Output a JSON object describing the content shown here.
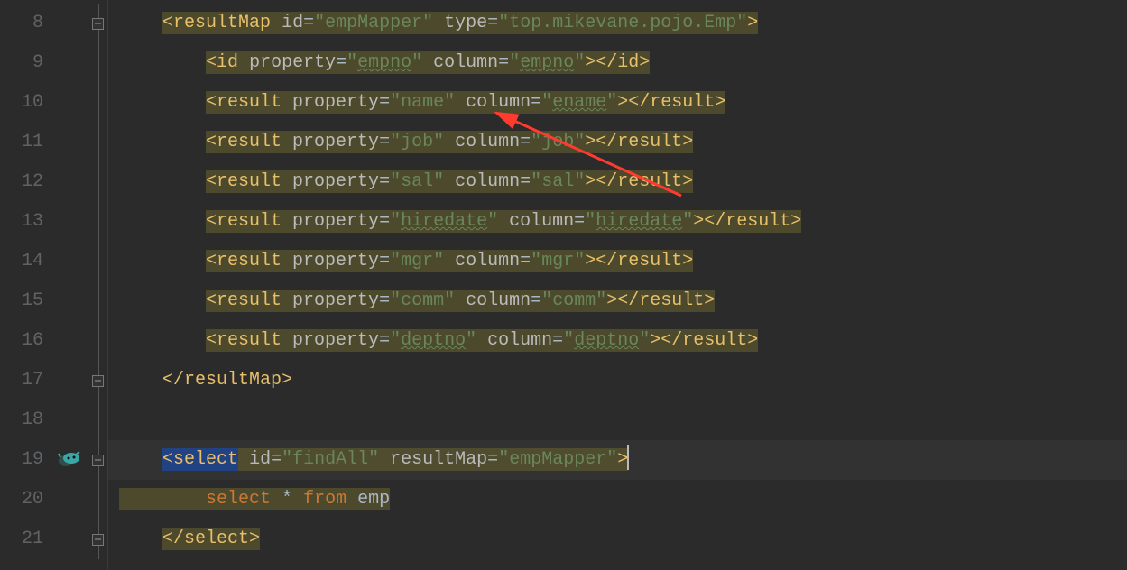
{
  "gutter": {
    "start": 8,
    "end": 21
  },
  "code": {
    "resultMap": {
      "open_tag": "resultMap",
      "id_attr": "id",
      "id_val": "\"empMapper\"",
      "type_attr": "type",
      "type_val": "\"top.mikevane.pojo.Emp\"",
      "close_tag": "resultMap"
    },
    "id_line": {
      "tag": "id",
      "prop_attr": "property",
      "prop_val": "\"",
      "prop_inner": "empno",
      "prop_val_end": "\"",
      "col_attr": "column",
      "col_val": "\"",
      "col_inner": "empno",
      "col_val_end": "\"",
      "close": "id"
    },
    "rows": [
      {
        "prop": "name",
        "col": "ename",
        "prop_wavy": false,
        "col_wavy": true
      },
      {
        "prop": "job",
        "col": "job",
        "prop_wavy": false,
        "col_wavy": false
      },
      {
        "prop": "sal",
        "col": "sal",
        "prop_wavy": false,
        "col_wavy": false
      },
      {
        "prop": "hiredate",
        "col": "hiredate",
        "prop_wavy": true,
        "col_wavy": true
      },
      {
        "prop": "mgr",
        "col": "mgr",
        "prop_wavy": false,
        "col_wavy": false
      },
      {
        "prop": "comm",
        "col": "comm",
        "prop_wavy": false,
        "col_wavy": false
      },
      {
        "prop": "deptno",
        "col": "deptno",
        "prop_wavy": true,
        "col_wavy": true
      }
    ],
    "result_tag": "result",
    "prop_attr": "property",
    "col_attr": "column",
    "select": {
      "tag": "select",
      "id_attr": "id",
      "id_val": "\"findAll\"",
      "rm_attr": "resultMap",
      "rm_val": "\"empMapper\"",
      "sql_select": "select",
      "sql_star": "*",
      "sql_from": "from",
      "sql_table": "emp",
      "close": "select"
    }
  }
}
